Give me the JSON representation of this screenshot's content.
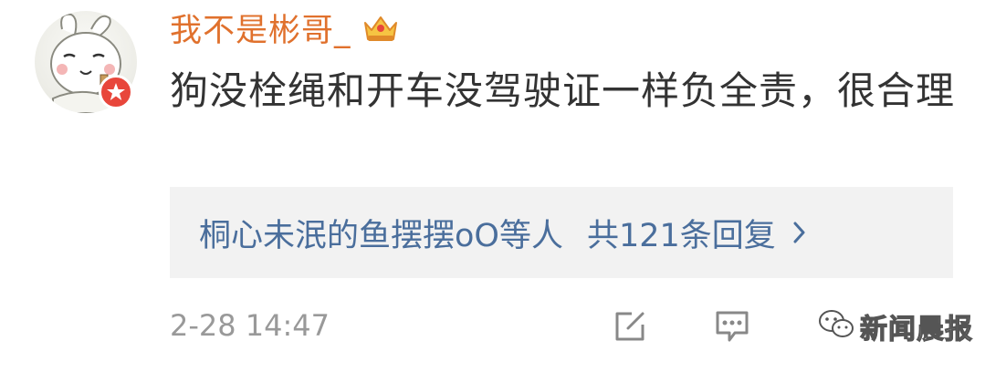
{
  "comment": {
    "username": "我不是彬哥_",
    "text": "狗没栓绳和开车没驾驶证一样负全责，很合理",
    "timestamp": "2-28 14:47"
  },
  "replies": {
    "names": "桐心未泯的鱼摆摆oO等人",
    "count_text": "共121条回复"
  },
  "icons": {
    "avatar": "cartoon-rabbit-avatar",
    "badge": "verified-star-icon",
    "crown": "crown-icon",
    "chevron": "chevron-right-icon",
    "edit": "edit-icon",
    "comment": "comment-icon",
    "like": "thumb-up-icon"
  },
  "watermark": "新闻晨报",
  "colors": {
    "username": "#e0712d",
    "link": "#4a6e9c",
    "text": "#333333",
    "muted": "#999999",
    "reply_bg": "#f2f2f2",
    "badge": "#e8463b"
  }
}
